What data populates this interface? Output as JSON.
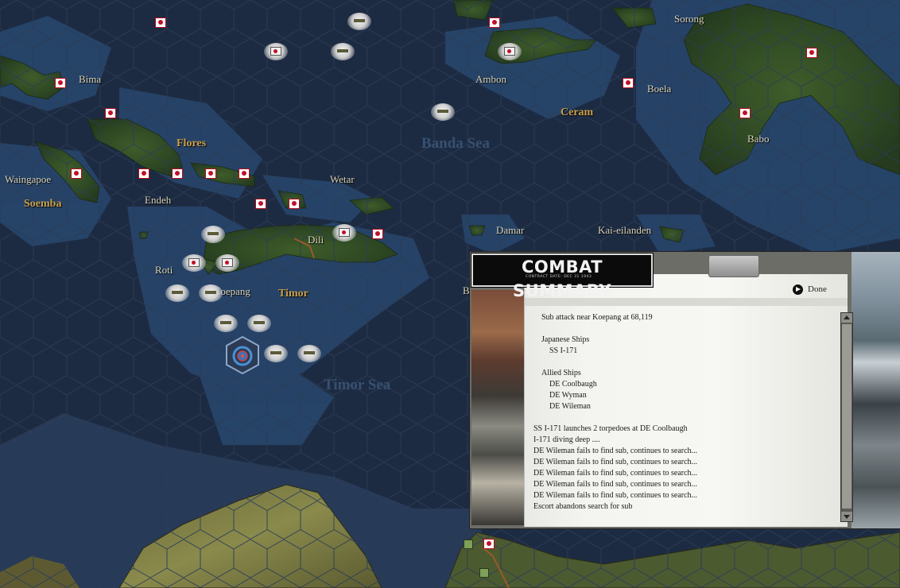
{
  "map": {
    "places": [
      {
        "name": "Bima",
        "kind": "town"
      },
      {
        "name": "Ambon",
        "kind": "town"
      },
      {
        "name": "Sorong",
        "kind": "town"
      },
      {
        "name": "Boela",
        "kind": "town"
      },
      {
        "name": "Ceram",
        "kind": "island"
      },
      {
        "name": "Flores",
        "kind": "island"
      },
      {
        "name": "Banda Sea",
        "kind": "sea"
      },
      {
        "name": "Babo",
        "kind": "town"
      },
      {
        "name": "Waingapoe",
        "kind": "town"
      },
      {
        "name": "Soemba",
        "kind": "island"
      },
      {
        "name": "Endeh",
        "kind": "town"
      },
      {
        "name": "Wetar",
        "kind": "town"
      },
      {
        "name": "Dili",
        "kind": "town"
      },
      {
        "name": "Damar",
        "kind": "town"
      },
      {
        "name": "Kai-eilanden",
        "kind": "town"
      },
      {
        "name": "Roti",
        "kind": "town"
      },
      {
        "name": "Koepang",
        "kind": "town"
      },
      {
        "name": "Timor",
        "kind": "island"
      },
      {
        "name": "Timor Sea",
        "kind": "sea"
      },
      {
        "name": "B",
        "kind": "town"
      }
    ]
  },
  "combat_summary": {
    "title": "COMBAT SUMMARY",
    "subtitle": "CONTRACT DATE: DEC 31 1943",
    "done_label": "Done",
    "report": {
      "header": "Sub attack near Koepang  at 68,119",
      "japanese_ships_label": "Japanese Ships",
      "japanese_ships": [
        "SS I-171"
      ],
      "allied_ships_label": "Allied Ships",
      "allied_ships": [
        "DE Coolbaugh",
        "DE Wyman",
        "DE Wileman"
      ],
      "events": [
        "SS I-171 launches 2 torpedoes at DE Coolbaugh",
        "I-171 diving deep ....",
        "DE Wileman fails to find sub, continues to search...",
        "DE Wileman fails to find sub, continues to search...",
        "DE Wileman fails to find sub, continues to search...",
        "DE Wileman fails to find sub, continues to search...",
        "DE Wileman fails to find sub, continues to search...",
        "Escort abandons search for sub"
      ]
    }
  }
}
